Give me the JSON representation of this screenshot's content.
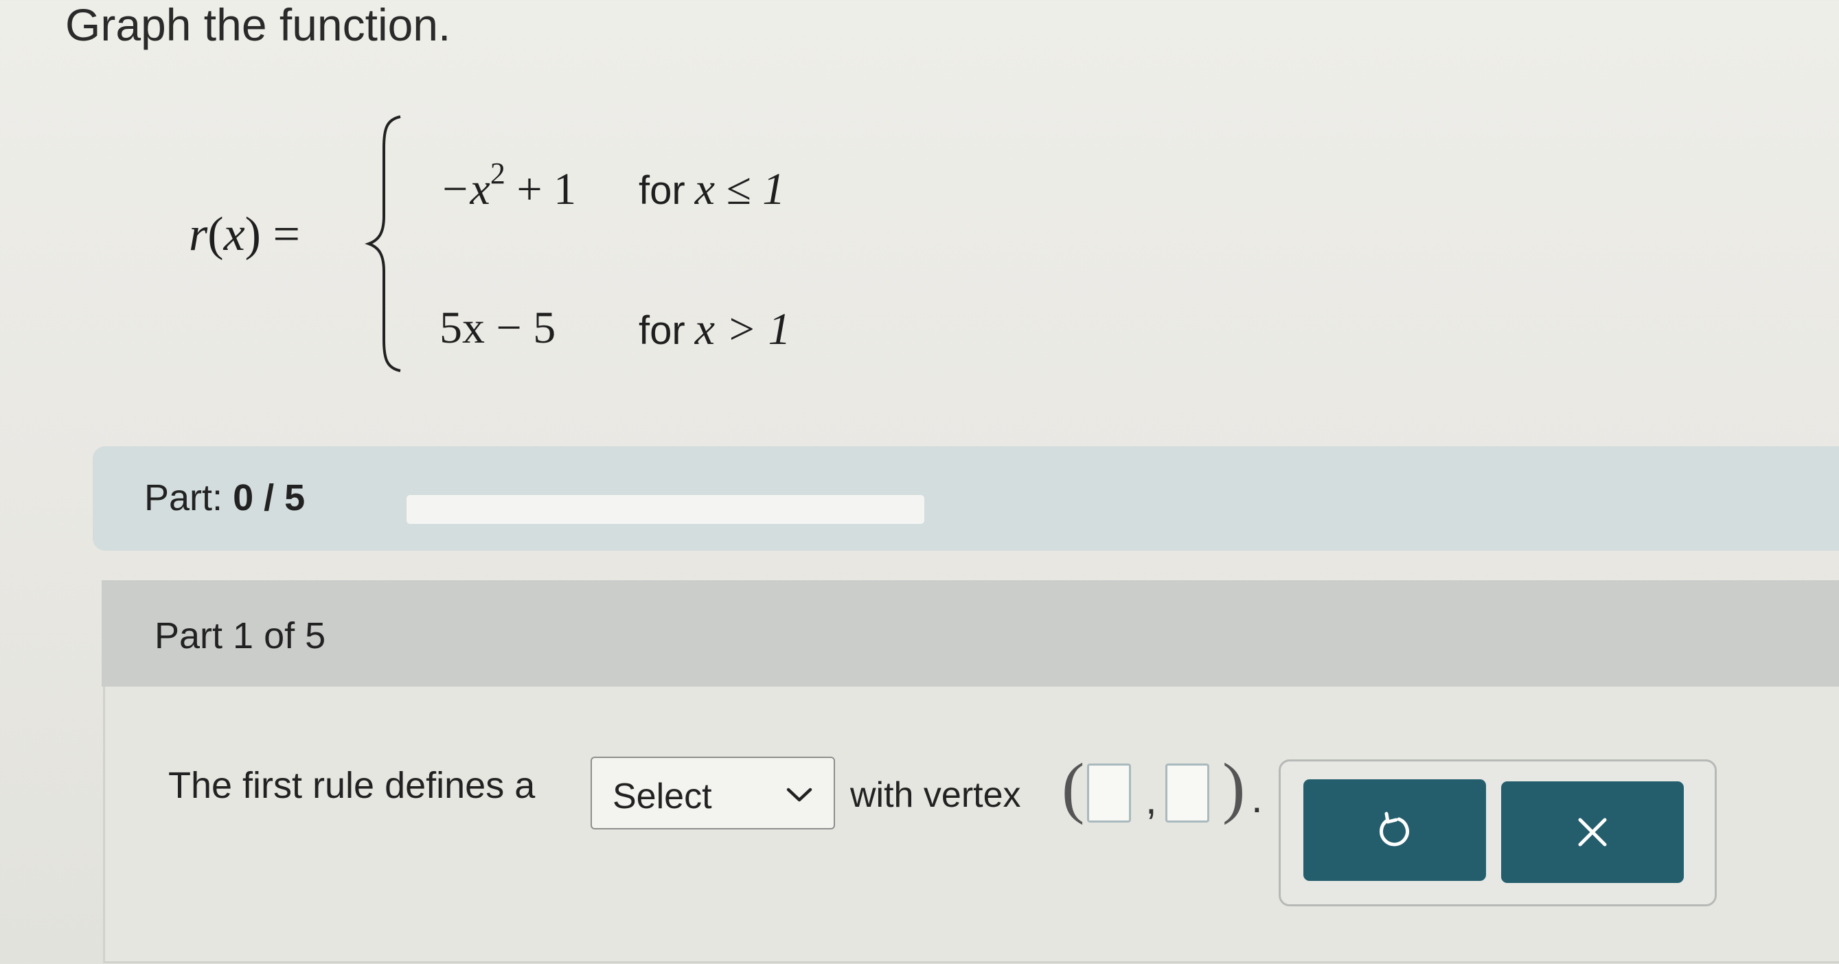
{
  "question": {
    "heading": "Graph the function."
  },
  "formula": {
    "function_name": "r",
    "variable": "x",
    "rule1": {
      "expression": "−x² + 1",
      "condition_word": "for",
      "condition": "x ≤ 1"
    },
    "rule2": {
      "expression": "5x − 5",
      "condition_word": "for",
      "condition": "x > 1"
    }
  },
  "progress": {
    "label": "Part:",
    "value_text": "0 / 5",
    "completed": 0,
    "total": 5,
    "fill_color": "#2f6f80"
  },
  "part": {
    "title": "Part 1 of 5",
    "sentence_prefix": "The first rule defines a",
    "select": {
      "selected": "Select",
      "icon": "chevron-down-icon"
    },
    "sentence_middle": "with vertex",
    "vertex_x": "",
    "vertex_y": "",
    "period": "."
  },
  "buttons": {
    "undo": {
      "icon": "undo-icon"
    },
    "clear": {
      "icon": "close-icon",
      "glyph": "×"
    },
    "color": "#245e6d"
  }
}
